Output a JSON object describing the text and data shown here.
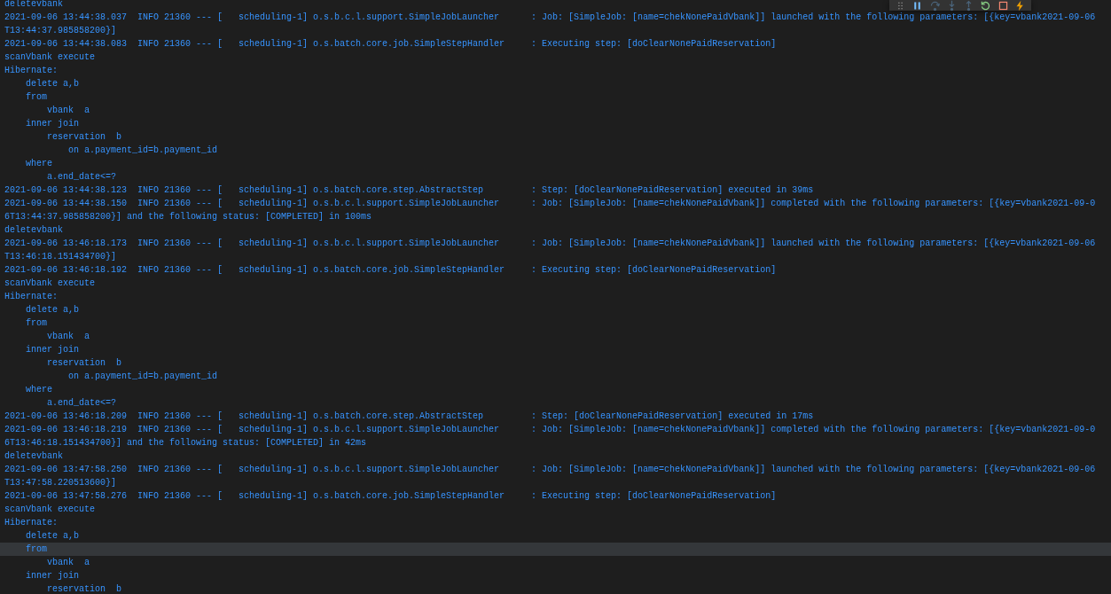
{
  "debug_toolbar": {
    "buttons": [
      {
        "kind": "gripper",
        "disabled": false
      },
      {
        "kind": "pause",
        "disabled": false
      },
      {
        "kind": "step_over",
        "disabled": true
      },
      {
        "kind": "step_into",
        "disabled": true
      },
      {
        "kind": "step_out",
        "disabled": true
      },
      {
        "kind": "restart",
        "disabled": false
      },
      {
        "kind": "stop",
        "disabled": false
      },
      {
        "kind": "hot_replace",
        "disabled": false
      }
    ]
  },
  "console": {
    "lines": [
      {
        "text": "deletevbank",
        "hovered": false
      },
      {
        "text": "2021-09-06 13:44:38.037  INFO 21360 --- [   scheduling-1] o.s.b.c.l.support.SimpleJobLauncher      : Job: [SimpleJob: [name=chekNonePaidVbank]] launched with the following parameters: [{key=vbank2021-09-06",
        "hovered": false
      },
      {
        "text": "T13:44:37.985858200}]",
        "hovered": false
      },
      {
        "text": "2021-09-06 13:44:38.083  INFO 21360 --- [   scheduling-1] o.s.batch.core.job.SimpleStepHandler     : Executing step: [doClearNonePaidReservation]",
        "hovered": false
      },
      {
        "text": "scanVbank execute",
        "hovered": false
      },
      {
        "text": "Hibernate:",
        "hovered": false
      },
      {
        "text": "    delete a,b",
        "hovered": false
      },
      {
        "text": "    from",
        "hovered": false
      },
      {
        "text": "        vbank  a",
        "hovered": false
      },
      {
        "text": "    inner join",
        "hovered": false
      },
      {
        "text": "        reservation  b",
        "hovered": false
      },
      {
        "text": "            on a.payment_id=b.payment_id",
        "hovered": false
      },
      {
        "text": "    where",
        "hovered": false
      },
      {
        "text": "        a.end_date<=?",
        "hovered": false
      },
      {
        "text": "2021-09-06 13:44:38.123  INFO 21360 --- [   scheduling-1] o.s.batch.core.step.AbstractStep         : Step: [doClearNonePaidReservation] executed in 39ms",
        "hovered": false
      },
      {
        "text": "2021-09-06 13:44:38.150  INFO 21360 --- [   scheduling-1] o.s.b.c.l.support.SimpleJobLauncher      : Job: [SimpleJob: [name=chekNonePaidVbank]] completed with the following parameters: [{key=vbank2021-09-0",
        "hovered": false
      },
      {
        "text": "6T13:44:37.985858200}] and the following status: [COMPLETED] in 100ms",
        "hovered": false
      },
      {
        "text": "deletevbank",
        "hovered": false
      },
      {
        "text": "2021-09-06 13:46:18.173  INFO 21360 --- [   scheduling-1] o.s.b.c.l.support.SimpleJobLauncher      : Job: [SimpleJob: [name=chekNonePaidVbank]] launched with the following parameters: [{key=vbank2021-09-06",
        "hovered": false
      },
      {
        "text": "T13:46:18.151434700}]",
        "hovered": false
      },
      {
        "text": "2021-09-06 13:46:18.192  INFO 21360 --- [   scheduling-1] o.s.batch.core.job.SimpleStepHandler     : Executing step: [doClearNonePaidReservation]",
        "hovered": false
      },
      {
        "text": "scanVbank execute",
        "hovered": false
      },
      {
        "text": "Hibernate:",
        "hovered": false
      },
      {
        "text": "    delete a,b",
        "hovered": false
      },
      {
        "text": "    from",
        "hovered": false
      },
      {
        "text": "        vbank  a",
        "hovered": false
      },
      {
        "text": "    inner join",
        "hovered": false
      },
      {
        "text": "        reservation  b",
        "hovered": false
      },
      {
        "text": "            on a.payment_id=b.payment_id",
        "hovered": false
      },
      {
        "text": "    where",
        "hovered": false
      },
      {
        "text": "        a.end_date<=?",
        "hovered": false
      },
      {
        "text": "2021-09-06 13:46:18.209  INFO 21360 --- [   scheduling-1] o.s.batch.core.step.AbstractStep         : Step: [doClearNonePaidReservation] executed in 17ms",
        "hovered": false
      },
      {
        "text": "2021-09-06 13:46:18.219  INFO 21360 --- [   scheduling-1] o.s.b.c.l.support.SimpleJobLauncher      : Job: [SimpleJob: [name=chekNonePaidVbank]] completed with the following parameters: [{key=vbank2021-09-0",
        "hovered": false
      },
      {
        "text": "6T13:46:18.151434700}] and the following status: [COMPLETED] in 42ms",
        "hovered": false
      },
      {
        "text": "deletevbank",
        "hovered": false
      },
      {
        "text": "2021-09-06 13:47:58.250  INFO 21360 --- [   scheduling-1] o.s.b.c.l.support.SimpleJobLauncher      : Job: [SimpleJob: [name=chekNonePaidVbank]] launched with the following parameters: [{key=vbank2021-09-06",
        "hovered": false
      },
      {
        "text": "T13:47:58.220513600}]",
        "hovered": false
      },
      {
        "text": "2021-09-06 13:47:58.276  INFO 21360 --- [   scheduling-1] o.s.batch.core.job.SimpleStepHandler     : Executing step: [doClearNonePaidReservation]",
        "hovered": false
      },
      {
        "text": "scanVbank execute",
        "hovered": false
      },
      {
        "text": "Hibernate:",
        "hovered": false
      },
      {
        "text": "    delete a,b",
        "hovered": false
      },
      {
        "text": "    from",
        "hovered": true
      },
      {
        "text": "        vbank  a",
        "hovered": false
      },
      {
        "text": "    inner join",
        "hovered": false
      },
      {
        "text": "        reservation  b",
        "hovered": false
      }
    ]
  }
}
